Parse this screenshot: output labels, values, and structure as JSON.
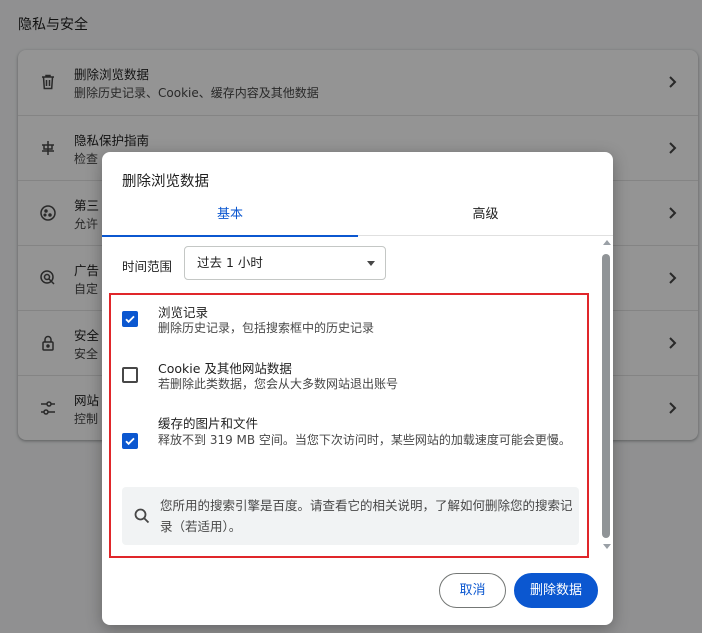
{
  "page": {
    "section_title": "隐私与安全"
  },
  "settings": {
    "rows": [
      {
        "icon": "trash-icon",
        "title": "删除浏览数据",
        "subtitle": "删除历史记录、Cookie、缓存内容及其他数据"
      },
      {
        "icon": "privacy-guide-icon",
        "title": "隐私保护指南",
        "subtitle": "检查"
      },
      {
        "icon": "cookie-icon",
        "title": "第三",
        "subtitle": "允许"
      },
      {
        "icon": "ad-privacy-icon",
        "title": "广告",
        "subtitle": "自定"
      },
      {
        "icon": "lock-icon",
        "title": "安全",
        "subtitle": "安全"
      },
      {
        "icon": "sliders-icon",
        "title": "网站",
        "subtitle": "控制"
      }
    ]
  },
  "dialog": {
    "title": "删除浏览数据",
    "tabs": [
      {
        "label": "基本",
        "selected": true
      },
      {
        "label": "高级",
        "selected": false
      }
    ],
    "time_range": {
      "label": "时间范围",
      "selected": "过去 1 小时"
    },
    "options": [
      {
        "title": "浏览记录",
        "subtitle": "删除历史记录，包括搜索框中的历史记录",
        "checked": true
      },
      {
        "title": "Cookie 及其他网站数据",
        "subtitle": "若删除此类数据，您会从大多数网站退出账号",
        "checked": false
      },
      {
        "title": "缓存的图片和文件",
        "subtitle": "释放不到 319 MB 空间。当您下次访问时，某些网站的加载速度可能会更慢。",
        "checked": true
      }
    ],
    "info": {
      "icon": "search-icon",
      "text": "您所用的搜索引擎是百度。请查看它的相关说明，了解如何删除您的搜索记录（若适用）。"
    },
    "buttons": {
      "cancel": "取消",
      "delete": "删除数据"
    }
  },
  "colors": {
    "accent": "#0b57d0",
    "highlight_border": "#e0262a"
  }
}
